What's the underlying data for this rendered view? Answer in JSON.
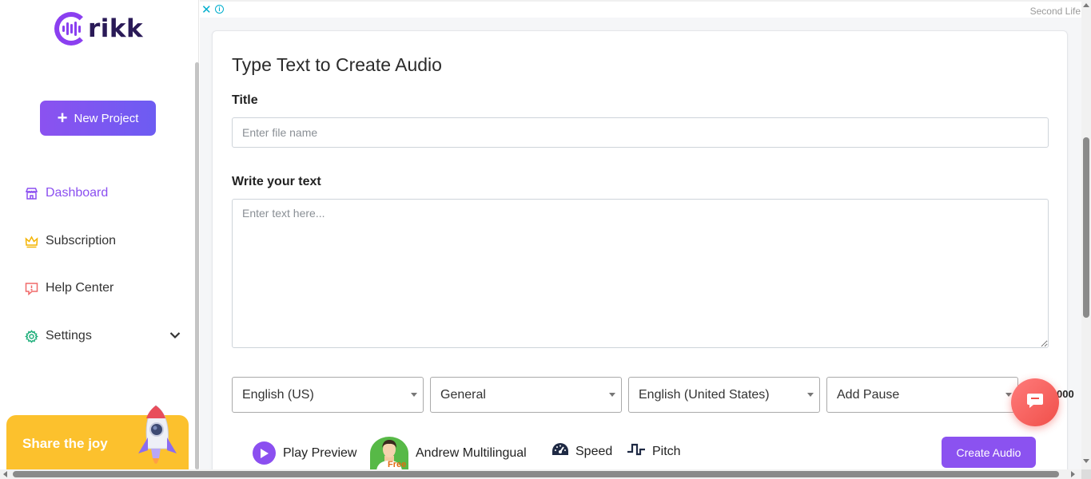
{
  "brand": {
    "name": "rikk",
    "accent": "#8b4ff0"
  },
  "sidebar": {
    "new_project_label": "New Project",
    "items": [
      {
        "label": "Dashboard",
        "icon": "storefront-icon",
        "active": true
      },
      {
        "label": "Subscription",
        "icon": "crown-icon"
      },
      {
        "label": "Help Center",
        "icon": "alert-chat-icon"
      },
      {
        "label": "Settings",
        "icon": "gear-icon",
        "has_submenu": true
      }
    ],
    "share_label": "Share the joy"
  },
  "ad": {
    "label": "Second Life",
    "close": "✕",
    "info": "i"
  },
  "form": {
    "heading": "Type Text to Create Audio",
    "title_label": "Title",
    "title_placeholder": "Enter file name",
    "text_label": "Write your text",
    "text_placeholder": "Enter text here...",
    "selects": [
      "English (US)",
      "General",
      "English (United States)",
      "Add Pause"
    ],
    "char_counter": "000",
    "play_preview_label": "Play Preview",
    "voice_name": "Andrew Multilingual",
    "voice_badge": "Free",
    "speed_label": "Speed",
    "pitch_label": "Pitch",
    "create_label": "Create Audio"
  }
}
